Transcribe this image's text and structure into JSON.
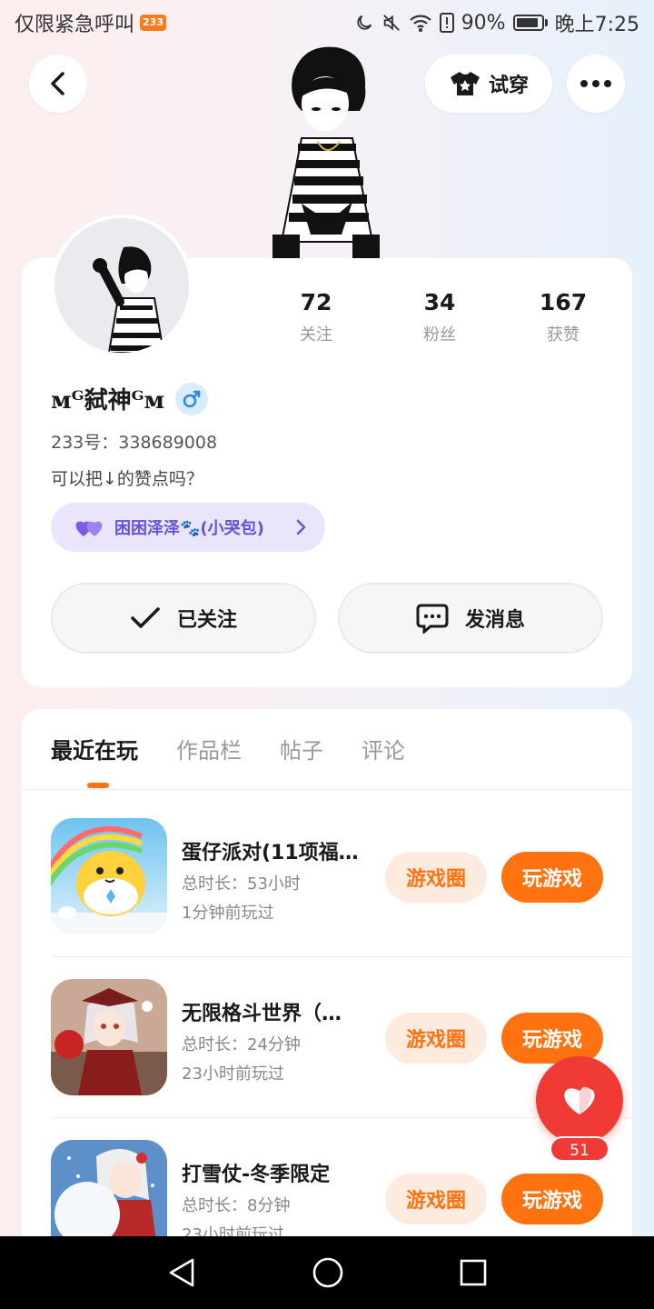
{
  "status_bar": {
    "carrier_text": "仅限紧急呼叫",
    "badge": "233",
    "battery": "90%",
    "time": "晚上7:25"
  },
  "header": {
    "try_on_label": "试穿"
  },
  "profile": {
    "stats": [
      {
        "value": "72",
        "label": "关注"
      },
      {
        "value": "34",
        "label": "粉丝"
      },
      {
        "value": "167",
        "label": "获赞"
      }
    ],
    "nickname": "ᴍᴳ弑神ᴳᴍ",
    "uid": "233号：338689008",
    "bio": "可以把↓的赞点吗？",
    "cp_tag": "困困泽泽🐾(小哭包)",
    "follow_label": "已关注",
    "message_label": "发消息"
  },
  "tabs": [
    "最近在玩",
    "作品栏",
    "帖子",
    "评论"
  ],
  "games": [
    {
      "title": "蛋仔派对(11项福…",
      "duration": "总时长：53小时",
      "last_played": "1分钟前玩过",
      "circle_label": "游戏圈",
      "play_label": "玩游戏"
    },
    {
      "title": "无限格斗世界（…",
      "duration": "总时长：24分钟",
      "last_played": "23小时前玩过",
      "circle_label": "游戏圈",
      "play_label": "玩游戏"
    },
    {
      "title": "打雪仗-冬季限定",
      "duration": "总时长：8分钟",
      "last_played": "23小时前玩过",
      "circle_label": "游戏圈",
      "play_label": "玩游戏"
    }
  ],
  "like_count": "51",
  "colors": {
    "accent": "#ff7210",
    "like": "#f03a36",
    "cp_text": "#6a52d8"
  }
}
